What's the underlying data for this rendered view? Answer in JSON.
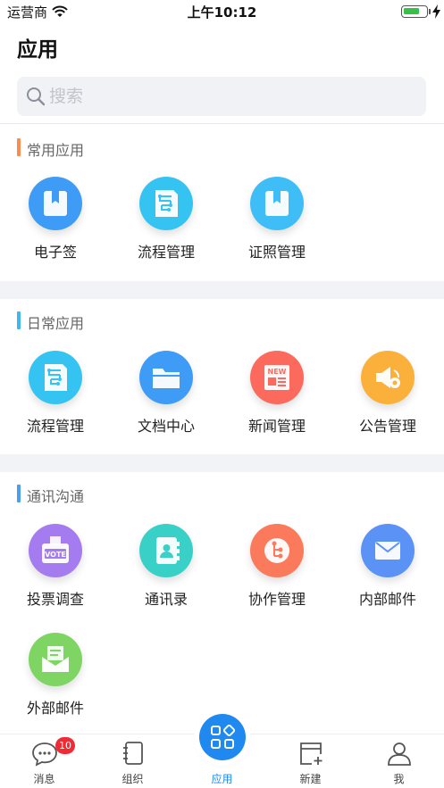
{
  "status_bar": {
    "carrier": "运营商",
    "time": "上午10:12",
    "battery_level": 0.72
  },
  "page_title": "应用",
  "search": {
    "placeholder": "搜索"
  },
  "sections": [
    {
      "title": "常用应用",
      "accent": "#ff8a4f",
      "apps": [
        {
          "label": "电子签",
          "icon": "bookmark-icon",
          "color": "#3f9cf6"
        },
        {
          "label": "流程管理",
          "icon": "workflow-document-icon",
          "color": "#35c4f2"
        },
        {
          "label": "证照管理",
          "icon": "bookmark-icon",
          "color": "#3fbdf6"
        }
      ]
    },
    {
      "title": "日常应用",
      "accent": "#3fb7f5",
      "apps": [
        {
          "label": "流程管理",
          "icon": "workflow-document-icon",
          "color": "#35c4f2"
        },
        {
          "label": "文档中心",
          "icon": "folder-icon",
          "color": "#3f9cf6"
        },
        {
          "label": "新闻管理",
          "icon": "news-icon",
          "color": "#fb6a5d"
        },
        {
          "label": "公告管理",
          "icon": "megaphone-icon",
          "color": "#fbb03b"
        }
      ]
    },
    {
      "title": "通讯沟通",
      "accent": "#4b9cf5",
      "apps": [
        {
          "label": "投票调查",
          "icon": "vote-box-icon",
          "color": "#a57cf0"
        },
        {
          "label": "通讯录",
          "icon": "contacts-book-icon",
          "color": "#39d0c8"
        },
        {
          "label": "协作管理",
          "icon": "collaboration-icon",
          "color": "#fb7a5c"
        },
        {
          "label": "内部邮件",
          "icon": "envelope-icon",
          "color": "#5b92f5"
        },
        {
          "label": "外部邮件",
          "icon": "open-envelope-icon",
          "color": "#7fd563"
        }
      ]
    }
  ],
  "vote_text": "VOTE",
  "news_text": "NEW",
  "tabbar": {
    "accent": "#1f89f0",
    "tabs": [
      {
        "label": "消息",
        "icon": "chat-bubble-icon",
        "badge": "10"
      },
      {
        "label": "组织",
        "icon": "notebook-icon"
      },
      {
        "label": "应用",
        "icon": "apps-grid-icon",
        "active": true
      },
      {
        "label": "新建",
        "icon": "new-document-icon"
      },
      {
        "label": "我",
        "icon": "person-icon"
      }
    ]
  }
}
